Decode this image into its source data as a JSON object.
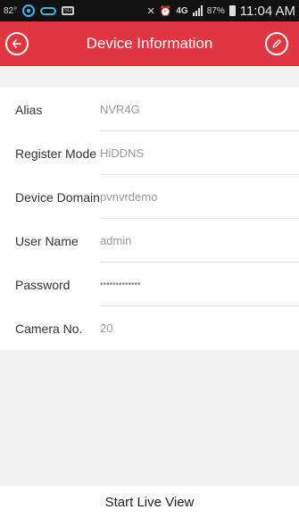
{
  "status_bar": {
    "temperature": "82°",
    "battery_percent": "87%",
    "network_label": "4G",
    "time": "11:04 AM"
  },
  "header": {
    "title": "Device Information",
    "back_icon": "back-circle-arrow-icon",
    "edit_icon": "pencil-edit-icon"
  },
  "fields": [
    {
      "label": "Alias",
      "value": "NVR4G"
    },
    {
      "label": "Register Mode",
      "value": "HiDDNS"
    },
    {
      "label": "Device Domain",
      "value": "pvnvrdemo"
    },
    {
      "label": "User Name",
      "value": "admin"
    },
    {
      "label": "Password",
      "value": "•••••••••••••"
    },
    {
      "label": "Camera No.",
      "value": "20"
    }
  ],
  "actions": {
    "start_live_view": "Start Live View"
  },
  "colors": {
    "header_bg": "#e03641",
    "status_bar_bg": "#111111",
    "label_text": "#333333",
    "value_text": "#999999"
  }
}
